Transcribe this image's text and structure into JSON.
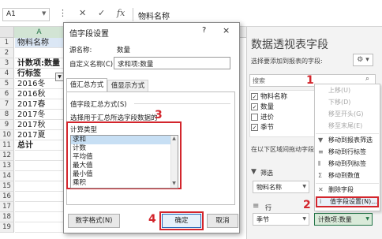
{
  "formula_bar": {
    "name_box": "A1",
    "content": "物料名称",
    "icons": [
      "more-icon",
      "cancel-icon",
      "confirm-icon",
      "function-icon"
    ]
  },
  "grid": {
    "column_header": "A",
    "rows": [
      {
        "num": "1",
        "value": "物料名称",
        "bold": false
      },
      {
        "num": "2",
        "value": "",
        "bold": false
      },
      {
        "num": "3",
        "value": "计数项:数量",
        "bold": true
      },
      {
        "num": "4",
        "value": "行标签",
        "bold": true
      },
      {
        "num": "5",
        "value": "2016冬",
        "bold": false
      },
      {
        "num": "6",
        "value": "2016秋",
        "bold": false
      },
      {
        "num": "7",
        "value": "2017春",
        "bold": false
      },
      {
        "num": "8",
        "value": "2017冬",
        "bold": false
      },
      {
        "num": "9",
        "value": "2017秋",
        "bold": false
      },
      {
        "num": "10",
        "value": "2017夏",
        "bold": false
      },
      {
        "num": "11",
        "value": "总计",
        "bold": true
      },
      {
        "num": "12",
        "value": "",
        "bold": false
      },
      {
        "num": "13",
        "value": "",
        "bold": false
      },
      {
        "num": "14",
        "value": "",
        "bold": false
      },
      {
        "num": "15",
        "value": "",
        "bold": false
      },
      {
        "num": "16",
        "value": "",
        "bold": false
      },
      {
        "num": "17",
        "value": "",
        "bold": false
      },
      {
        "num": "18",
        "value": "",
        "bold": false
      },
      {
        "num": "19",
        "value": "",
        "bold": false
      }
    ]
  },
  "dialog": {
    "title": "值字段设置",
    "help": "?",
    "close": "×",
    "source_label": "源名称:",
    "source_value": "数量",
    "custom_name_label": "自定义名称(C):",
    "custom_name_value": "求和项:数量",
    "tabs": [
      "值汇总方式",
      "值显示方式"
    ],
    "section_header": "值字段汇总方式(S)",
    "choose_label": "选择用于汇总所选字段数据的",
    "calc_type_label": "计算类型",
    "calc_types": [
      "求和",
      "计数",
      "平均值",
      "最大值",
      "最小值",
      "乘积"
    ],
    "selected_index": 0,
    "buttons": {
      "number_format": "数字格式(N)",
      "ok": "确定",
      "cancel": "取消"
    }
  },
  "panel": {
    "title": "数据透视表字段",
    "subtitle": "选择要添加到报表的字段:",
    "search_placeholder": "搜索",
    "fields": [
      {
        "name": "物料名称",
        "checked": true
      },
      {
        "name": "数量",
        "checked": true
      },
      {
        "name": "进价",
        "checked": false
      },
      {
        "name": "季节",
        "checked": true
      }
    ],
    "areas_label": "在以下区域间拖动字段:",
    "filter_label": "筛选",
    "filter_field": "物料名称",
    "rows_label": "行",
    "rows_field": "季节",
    "values_field": "计数项:数量"
  },
  "context_menu": {
    "items": [
      {
        "label": "上移(U)",
        "disabled": true
      },
      {
        "label": "下移(D)",
        "disabled": true
      },
      {
        "label": "移至开头(G)",
        "disabled": true
      },
      {
        "label": "移至末尾(E)",
        "disabled": true
      },
      {
        "label": "移动到报表筛选",
        "disabled": false
      },
      {
        "label": "移动到行标签",
        "disabled": false
      },
      {
        "label": "移动到列标签",
        "disabled": false
      },
      {
        "label": "移动到数值",
        "disabled": false
      },
      {
        "label": "删除字段",
        "disabled": false
      },
      {
        "label": "值字段设置(N)...",
        "disabled": false
      }
    ]
  },
  "callouts": [
    "1",
    "2",
    "3",
    "4"
  ],
  "colors": {
    "accent": "#217346",
    "highlight": "#d3252c",
    "selection": "#c7dff4"
  }
}
